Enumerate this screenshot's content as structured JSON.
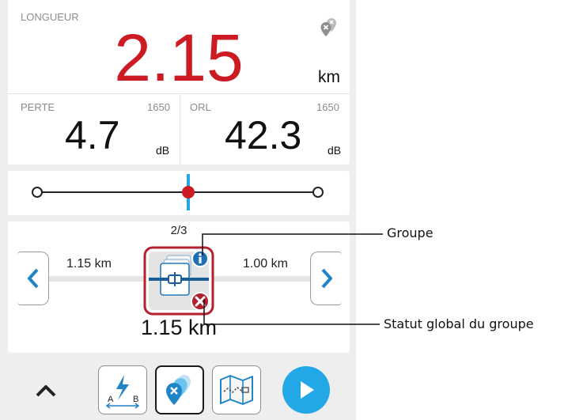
{
  "length": {
    "label": "LONGUEUR",
    "value": "2.15",
    "unit": "km",
    "icon": "markers-icon"
  },
  "loss": {
    "label": "PERTE",
    "wavelength": "1650",
    "value": "4.7",
    "unit": "dB"
  },
  "orl": {
    "label": "ORL",
    "wavelength": "1650",
    "value": "42.3",
    "unit": "dB"
  },
  "slider": {
    "track_color": "#222222",
    "marker_color": "#cc1b22",
    "cursor_color": "#22a8e6"
  },
  "element": {
    "counter": "2/3",
    "dist_left": "1.15 km",
    "dist_right": "1.00 km",
    "total_distance": "1.15 km",
    "prev_icon": "chevron-left-icon",
    "next_icon": "chevron-right-icon",
    "status_colors": {
      "info": "#1f6fb3",
      "fail": "#b5202f"
    }
  },
  "toolbar": {
    "items": [
      "chevron-up-icon",
      "otdr-test-icon",
      "markers-icon",
      "map-icon",
      "play-icon"
    ],
    "accent": "#22a8e6"
  },
  "callouts": {
    "group": "Groupe",
    "group_status": "Statut global du groupe"
  }
}
